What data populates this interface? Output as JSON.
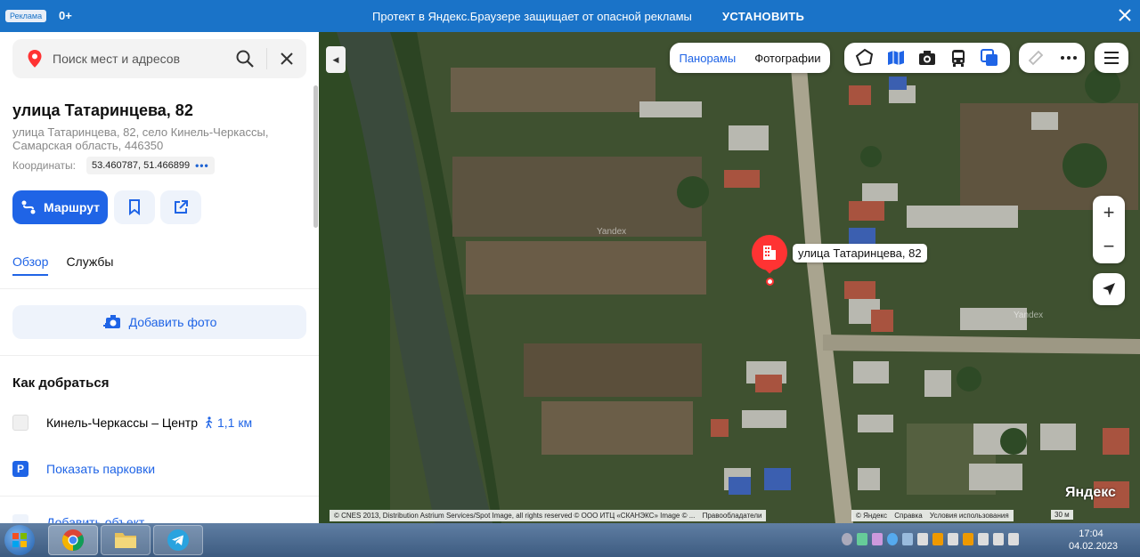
{
  "ad": {
    "badge": "Реклама",
    "age": "0+",
    "text": "Протект в Яндекс.Браузере защищает от опасной рекламы",
    "install": "УСТАНОВИТЬ"
  },
  "search": {
    "placeholder": "Поиск мест и адресов"
  },
  "place": {
    "title": "улица Татаринцева, 82",
    "address": "улица Татаринцева, 82, село Кинель-Черкассы, Самарская область, 446350",
    "coords_label": "Координаты:",
    "coords_value": "53.460787, 51.466899",
    "coords_more": "•••"
  },
  "actions": {
    "route": "Маршрут"
  },
  "tabs": [
    {
      "label": "Обзор"
    },
    {
      "label": "Службы"
    }
  ],
  "add_photo": "Добавить фото",
  "how_to_get": {
    "heading": "Как добраться",
    "stop": "Кинель-Черкассы – Центр",
    "distance": "1,1 км",
    "parking": "Показать парковки",
    "add_object": "Добавить объект"
  },
  "map": {
    "panoramas": "Панорамы",
    "photos": "Фотографии",
    "marker_label": "улица Татаринцева, 82",
    "watermark": "Yandex",
    "copyright": "© CNES 2013, Distribution Astrium Services/Spot Image, all rights reserved © ООО ИТЦ «СКАНЭКС» Image © ...",
    "rights_holders": "Правообладатели",
    "yandex_copy": "© Яндекс",
    "help": "Справка",
    "terms": "Условия использования",
    "logo": "Яндекс",
    "scale": "30 м",
    "zoom_in": "+",
    "zoom_out": "−"
  },
  "taskbar": {
    "time": "17:04",
    "date": "04.02.2023"
  },
  "colors": {
    "accent": "#1f64e6",
    "ad_bar": "#1a73c8",
    "marker": "#ff3333"
  }
}
